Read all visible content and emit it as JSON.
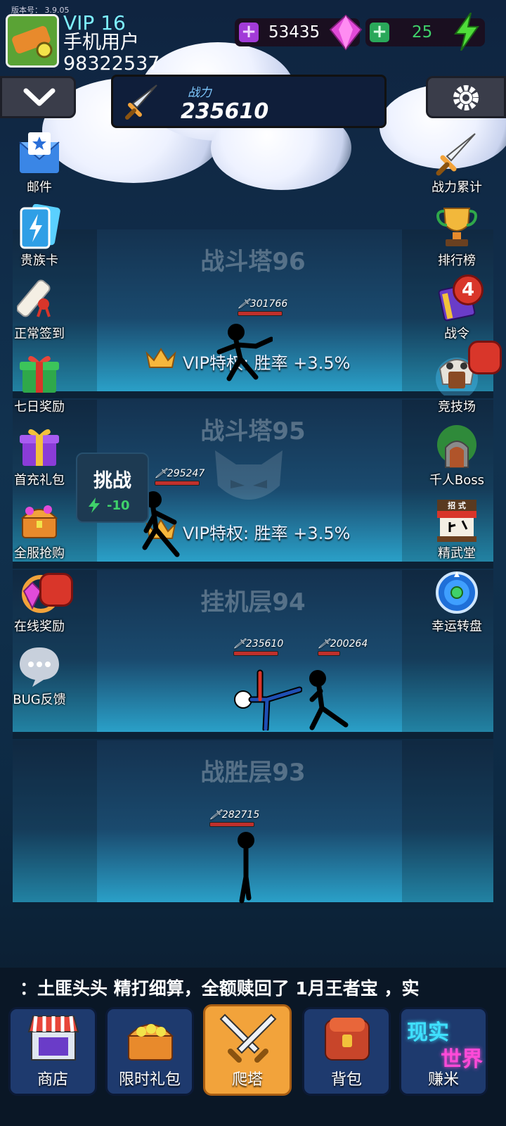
{
  "header": {
    "version": "版本号： 3.9.05",
    "vip": "VIP 16",
    "username": "手机用户98322537",
    "gems": "53435",
    "energy": "25"
  },
  "power": {
    "label": "战力",
    "value": "235610"
  },
  "left_menu": [
    {
      "label": "邮件",
      "icon": "mail-icon"
    },
    {
      "label": "贵族卡",
      "icon": "noble-card-icon"
    },
    {
      "label": "正常签到",
      "icon": "scroll-icon"
    },
    {
      "label": "七日奖励",
      "icon": "gift-icon"
    },
    {
      "label": "首充礼包",
      "icon": "purple-gift-icon"
    },
    {
      "label": "全服抢购",
      "icon": "treasure-chest-icon"
    },
    {
      "label": "在线奖励",
      "icon": "timer-gem-icon"
    },
    {
      "label": "BUG反馈",
      "icon": "chat-bubble-icon"
    }
  ],
  "right_menu": [
    {
      "label": "战力累计",
      "icon": "sword-icon"
    },
    {
      "label": "排行榜",
      "icon": "trophy-icon"
    },
    {
      "label": "战令",
      "icon": "book-icon",
      "badge": "4"
    },
    {
      "label": "竞技场",
      "icon": "skull-arena-icon"
    },
    {
      "label": "千人Boss",
      "icon": "tree-gate-icon"
    },
    {
      "label": "精武堂",
      "icon": "martial-hall-icon",
      "sign": "招 式"
    },
    {
      "label": "幸运转盘",
      "icon": "wheel-icon"
    }
  ],
  "floors": [
    {
      "title": "战斗塔96",
      "vip": "VIP特权: 胜率 +3.5%",
      "powers": [
        "301766"
      ]
    },
    {
      "title": "战斗塔95",
      "vip": "VIP特权: 胜率 +3.5%",
      "powers": [
        "295247"
      ]
    },
    {
      "title": "挂机层94",
      "powers": [
        "235610",
        "200264"
      ]
    },
    {
      "title": "战胜层93",
      "powers": [
        "282715"
      ]
    }
  ],
  "challenge": {
    "label": "挑战",
    "cost": "-10"
  },
  "ticker": "：土匪头头 精打细算，全额赎回了 1月王者宝 ，实",
  "nav": [
    {
      "label": "商店",
      "icon": "shop-icon"
    },
    {
      "label": "限时礼包",
      "icon": "chest-icon"
    },
    {
      "label": "爬塔",
      "icon": "crossed-swords-icon"
    },
    {
      "label": "背包",
      "icon": "backpack-icon"
    },
    {
      "label": "赚米",
      "icon": "real-world-icon",
      "logo_top": "现实",
      "logo_bottom": "世界"
    }
  ],
  "colors": {
    "accent": "#f2a33b",
    "vip": "#7ef0ff",
    "energy": "#3fd16a",
    "gem": "#e24bd8"
  }
}
